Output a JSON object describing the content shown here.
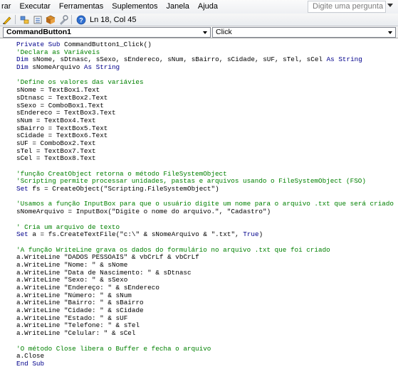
{
  "menubar": {
    "items": [
      "rar",
      "Executar",
      "Ferramentas",
      "Suplementos",
      "Janela",
      "Ajuda"
    ],
    "help_placeholder": "Digite uma pergunta"
  },
  "toolbar": {
    "status": "Ln 18, Col 45"
  },
  "dropdowns": {
    "object": "CommandButton1",
    "procedure": "Click"
  },
  "colors": {
    "keyword": "#00008b",
    "comment": "#008000",
    "text": "#000000"
  },
  "code": {
    "lines": [
      "Private Sub CommandButton1_Click()",
      "'Declara as Variáveis",
      "Dim sNome, sDtnasc, sSexo, sEndereco, sNum, sBairro, sCidade, sUF, sTel, sCel As String",
      "Dim sNomeArquivo As String",
      "",
      "'Define os valores das variávies",
      "sNome = TextBox1.Text",
      "sDtnasc = TextBox2.Text",
      "sSexo = ComboBox1.Text",
      "sEndereco = TextBox3.Text",
      "sNum = TextBox4.Text",
      "sBairro = TextBox5.Text",
      "sCidade = TextBox6.Text",
      "sUF = ComboBox2.Text",
      "sTel = TextBox7.Text",
      "sCel = TextBox8.Text",
      "",
      "'função CreatObject retorna o método FileSystemObject",
      "'Scripting permite processar unidades, pastas e arquivos usando o FileSystemObject (FSO)",
      "Set fs = CreateObject(\"Scripting.FileSystemObject\")",
      "",
      "'Usamos a função InputBox para que o usuário digite um nome para o arquivo .txt que será criado",
      "sNomeArquivo = InputBox(\"Digite o nome do arquivo.\", \"Cadastro\")",
      "",
      "' Cria um arquivo de texto",
      "Set a = fs.CreateTextFile(\"c:\\\" & sNomeArquivo & \".txt\", True)",
      "",
      "'A função WriteLine grava os dados do formulário no arquivo .txt que foi criado",
      "a.WriteLine \"DADOS PESSOAIS\" & vbCrLf & vbCrLf",
      "a.WriteLine \"Nome: \" & sNome",
      "a.WriteLine \"Data de Nascimento: \" & sDtnasc",
      "a.WriteLine \"Sexo: \" & sSexo",
      "a.WriteLine \"Endereço: \" & sEndereco",
      "a.WriteLine \"Número: \" & sNum",
      "a.WriteLine \"Bairro: \" & sBairro",
      "a.WriteLine \"Cidade: \" & sCidade",
      "a.WriteLine \"Estado: \" & sUF",
      "a.WriteLine \"Telefone: \" & sTel",
      "a.WriteLine \"Celular: \" & sCel",
      "",
      "'O método Close libera o Buffer e fecha o arquivo",
      "a.Close",
      "End Sub"
    ]
  }
}
